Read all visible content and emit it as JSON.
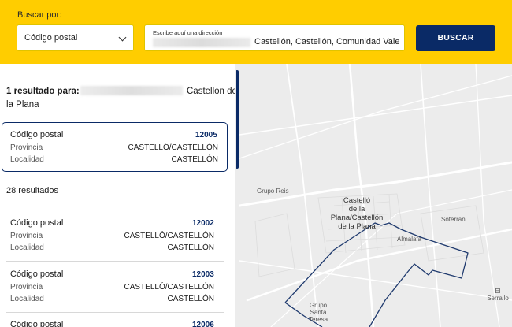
{
  "search": {
    "label": "Buscar por:",
    "select_value": "Código postal",
    "address_label": "Escribe aquí una dirección",
    "address_value": "Castellón, Castellón, Comunidad Vale",
    "button_label": "BUSCAR"
  },
  "results": {
    "header_bold": "1 resultado para:",
    "header_city_a": "Castellon de",
    "header_city_b": "la Plana",
    "selected": {
      "postal_label": "Código postal",
      "postal_value": "12005",
      "province_label": "Provincia",
      "province_value": "CASTELLÓ/CASTELLÓN",
      "locality_label": "Localidad",
      "locality_value": "CASTELLÓN"
    },
    "count_label": "28 resultados",
    "items": [
      {
        "postal_label": "Código postal",
        "postal_value": "12002",
        "province_label": "Provincia",
        "province_value": "CASTELLÓ/CASTELLÓN",
        "locality_label": "Localidad",
        "locality_value": "CASTELLÓN"
      },
      {
        "postal_label": "Código postal",
        "postal_value": "12003",
        "province_label": "Provincia",
        "province_value": "CASTELLÓ/CASTELLÓN",
        "locality_label": "Localidad",
        "locality_value": "CASTELLÓN"
      },
      {
        "postal_label": "Código postal",
        "postal_value": "12006"
      }
    ]
  },
  "map": {
    "labels": {
      "grupo_reis": "Grupo Reis",
      "city_l1": "Castelló",
      "city_l2": "de la",
      "city_l3": "Plana/Castellón",
      "city_l4": "de la Plana",
      "soterrani": "Soterrani",
      "almalafa": "Almalafa",
      "grupo_santa_l1": "Grupo",
      "grupo_santa_l2": "Santa",
      "grupo_santa_l3": "Teresa",
      "el_serrallo": "El Serrallo"
    },
    "boundary_color": "#1f3a6e"
  },
  "colors": {
    "header_bg": "#ffcd00",
    "accent": "#0a2a66"
  }
}
